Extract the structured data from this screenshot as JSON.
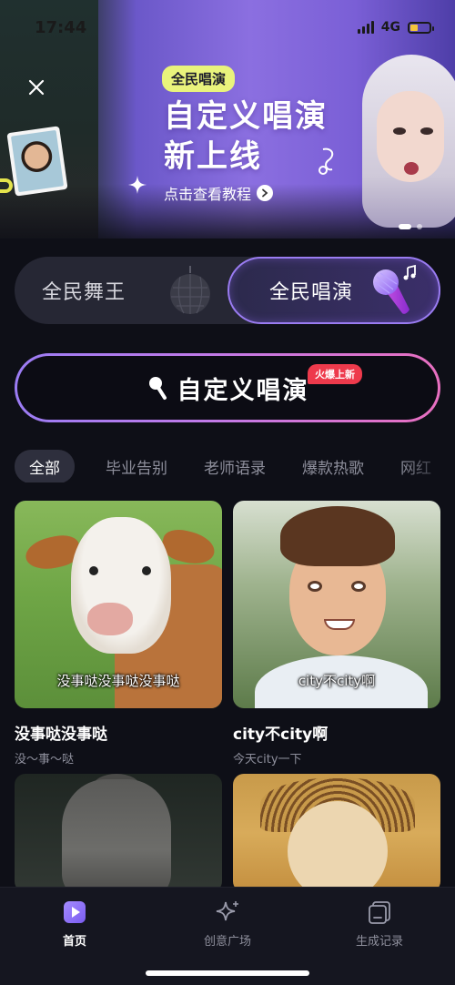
{
  "status_bar": {
    "time": "17:44",
    "network": "4G"
  },
  "banner": {
    "tag": "全民唱演",
    "title_line1": "自定义唱演",
    "title_line2": "新上线",
    "subtitle": "点击查看教程"
  },
  "mode_toggle": {
    "left_label": "全民舞王",
    "right_label": "全民唱演"
  },
  "custom_button": {
    "label": "自定义唱演",
    "badge": "火爆上新"
  },
  "tabs": [
    "全部",
    "毕业告别",
    "老师语录",
    "爆款热歌",
    "网红"
  ],
  "cards": [
    {
      "overlay": "没事哒没事哒没事哒",
      "title": "没事哒没事哒",
      "subtitle": "没～事～哒"
    },
    {
      "overlay": "city不city啊",
      "title": "city不city啊",
      "subtitle": "今天city一下"
    }
  ],
  "bottom_nav": [
    {
      "label": "首页",
      "icon": "play-square-icon"
    },
    {
      "label": "创意广场",
      "icon": "sparkle-icon"
    },
    {
      "label": "生成记录",
      "icon": "history-icon"
    }
  ],
  "colors": {
    "background": "#0e0f17",
    "accent_purple": "#9a7cf2",
    "badge_red": "#ee3a4c",
    "tag_yellow": "#e9f37c"
  }
}
